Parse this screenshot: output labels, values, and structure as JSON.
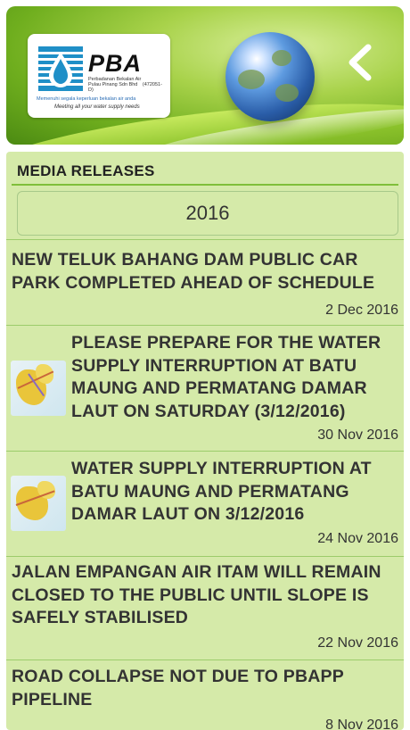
{
  "header": {
    "logo": {
      "brand": "PBA",
      "company_lines": [
        "Perbadanan Bekalan Air",
        "Pulau Pinang Sdn Bhd",
        "(472051-D)"
      ],
      "tagline_malay": "Memenuhi segala keperluan bekalan air anda",
      "tagline_english": "Meeting all your water supply needs"
    },
    "back_icon": "chevron-left-icon"
  },
  "section": {
    "title": "MEDIA RELEASES",
    "year_selector": "2016"
  },
  "releases": [
    {
      "title_lines": [
        "NEW TELUK BAHANG DAM PUBLIC CAR",
        "PARK COMPLETED AHEAD OF SCHEDULE"
      ],
      "date": "2 Dec 2016",
      "has_thumbnail": false
    },
    {
      "title_lines": [
        "PLEASE PREPARE FOR THE WATER",
        "SUPPLY INTERRUPTION AT BATU",
        "MAUNG AND PERMATANG DAMAR",
        "LAUT ON SATURDAY (3/12/2016)"
      ],
      "date": "30 Nov 2016",
      "has_thumbnail": true
    },
    {
      "title_lines": [
        "WATER SUPPLY INTERRUPTION AT",
        "BATU MAUNG AND PERMATANG",
        "DAMAR LAUT ON 3/12/2016"
      ],
      "date": "24 Nov 2016",
      "has_thumbnail": true
    },
    {
      "title_lines": [
        "JALAN EMPANGAN AIR ITAM WILL REMAIN",
        "CLOSED TO THE PUBLIC UNTIL SLOPE IS",
        "SAFELY STABILISED"
      ],
      "date": "22 Nov 2016",
      "has_thumbnail": false
    },
    {
      "title_lines": [
        "ROAD COLLAPSE NOT DUE TO PBAPP",
        "PIPELINE"
      ],
      "date": "8 Nov 2016",
      "has_thumbnail": false
    }
  ],
  "colors": {
    "panel_bg": "#d5eaa9",
    "divider": "#9ccc6b",
    "accent_green": "#7fbf3a"
  }
}
